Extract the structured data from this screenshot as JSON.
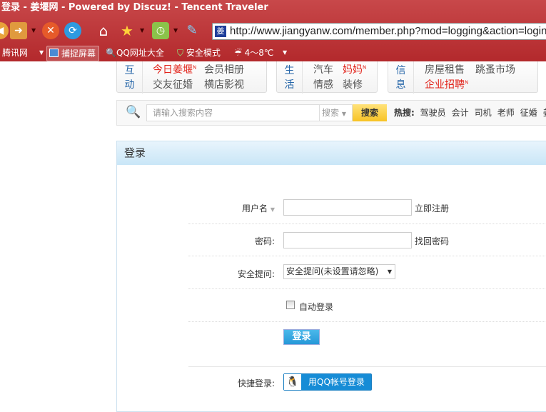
{
  "browser": {
    "title": "登录 - 姜堰网 - Powered by Discuz! - Tencent Traveler",
    "address": "http://www.jiangyanw.com/member.php?mod=logging&action=login",
    "favicon_char": "姜",
    "links": [
      "腾讯网",
      "捕捉屏幕",
      "QQ网址大全",
      "安全模式",
      "4～8℃"
    ]
  },
  "nav": [
    {
      "category": "互动",
      "items": [
        "今日姜堰",
        "会员相册",
        "交友征婚",
        "横店影视"
      ]
    },
    {
      "category": "生活",
      "items": [
        "汽车",
        "妈妈",
        "情感",
        "装修"
      ]
    },
    {
      "category": "信息",
      "items": [
        "房屋租售",
        "跳蚤市场",
        "企业招聘"
      ]
    }
  ],
  "search": {
    "placeholder": "请输入搜索内容",
    "type": "搜索",
    "button": "搜索",
    "hot_label": "热搜:",
    "hot": [
      "驾驶员",
      "会计",
      "司机",
      "老师",
      "征婚",
      "姜"
    ]
  },
  "login": {
    "title": "登录",
    "username_label": "用户名",
    "register_link": "立即注册",
    "password_label": "密码:",
    "forgot_link": "找回密码",
    "question_label": "安全提问:",
    "question_value": "安全提问(未设置请忽略)",
    "autologin_label": "自动登录",
    "autologin_checked": false,
    "submit": "登录",
    "quick_label": "快捷登录:",
    "qq_button": "用QQ帐号登录"
  }
}
